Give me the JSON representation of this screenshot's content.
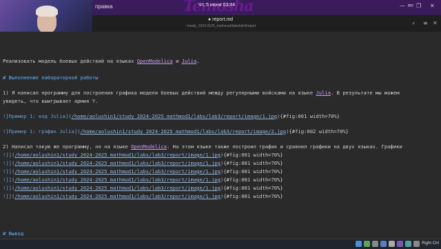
{
  "topbar": {
    "menu_label": "правка",
    "clock": "Чт, 5 июня  03:44",
    "watermark": "Temosha",
    "lang": "en"
  },
  "window": {
    "title": "report.md",
    "path": "~/study_2024-2025_mathmod/labs/lab3/report"
  },
  "editor": {
    "lines": {
      "l1_a": "Реализовать модель боевых действий на языках ",
      "l1_b": "OpenModelica",
      "l1_c": " и ",
      "l1_d": "Julia",
      "l1_e": ".",
      "h1": "# Выполнение лабораторной работы",
      "p1_a": "1) Я написал программу для построения графика модели боевых действий между регулярными войсками на языке ",
      "p1_b": "Julia",
      "p1_c": ". В результате мы можем",
      "p1_d": "увидеть, что выигрывает армия Y.",
      "img1_alt": "![Пример 1: код Julia]",
      "img1_path": "/home/aolushin1/study_2024-2025_mathmod1/labs/lab3/report/image/1.jpg",
      "img1_attr": "{#fig:001 width=70%}",
      "img2_alt": "![Пример 1: график Julia]",
      "img2_path": "/home/aolushin1/study_2024-2025_mathmod1/labs/lab3/report/image/2.jpg",
      "img2_attr": "{#fig:002 width=70%}",
      "p2_a": "2) Написал такую же программу, но на языке ",
      "p2_b": "OpenModelica",
      "p2_c": ". На этом языке также построил график и сравнил графики на двух языках. Графики",
      "rep_alt": "![]",
      "rep_path": "/home/aolushin1/study_2024-2025_mathmod1/labs/lab3/report/image/1.jpg",
      "rep_attr": "{#fig:001 width=70%}",
      "h2": "# Вывод"
    }
  },
  "taskbar": {
    "right_ctrl": "Right Ctrl"
  }
}
